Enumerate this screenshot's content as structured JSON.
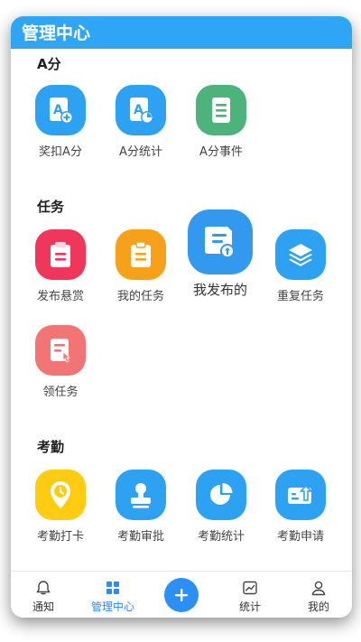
{
  "header": {
    "title": "管理中心"
  },
  "sections": {
    "a_score": {
      "title": "A分",
      "items": [
        {
          "label": "奖扣A分",
          "icon": "a-score-add-icon",
          "color": "#2ea2f2"
        },
        {
          "label": "A分统计",
          "icon": "a-score-stats-icon",
          "color": "#2ea2f2"
        },
        {
          "label": "A分事件",
          "icon": "a-score-events-icon",
          "color": "#4cb37a"
        }
      ]
    },
    "tasks": {
      "title": "任务",
      "items": [
        {
          "label": "发布悬赏",
          "icon": "publish-bounty-icon",
          "color": "#f0365a"
        },
        {
          "label": "我的任务",
          "icon": "my-tasks-icon",
          "color": "#f7a11b"
        },
        {
          "label": "我发布的",
          "icon": "my-published-icon",
          "color": "#3399ee"
        },
        {
          "label": "重复任务",
          "icon": "repeat-task-icon",
          "color": "#2ea2f2"
        },
        {
          "label": "领任务",
          "icon": "claim-task-icon",
          "color": "#f27474"
        }
      ]
    },
    "attendance": {
      "title": "考勤",
      "items": [
        {
          "label": "考勤打卡",
          "icon": "check-in-icon",
          "color": "#ffcc11"
        },
        {
          "label": "考勤审批",
          "icon": "attendance-approval-icon",
          "color": "#2ea2f2"
        },
        {
          "label": "考勤统计",
          "icon": "attendance-stats-icon",
          "color": "#2ea2f2"
        },
        {
          "label": "考勤申请",
          "icon": "attendance-request-icon",
          "color": "#2ea2f2"
        }
      ]
    }
  },
  "tabbar": {
    "items": [
      {
        "label": "通知",
        "icon": "bell-icon",
        "active": false
      },
      {
        "label": "管理中心",
        "icon": "grid-icon",
        "active": true
      },
      {
        "label": "统计",
        "icon": "chart-icon",
        "active": false
      },
      {
        "label": "我的",
        "icon": "user-icon",
        "active": false
      }
    ],
    "center_icon": "plus-icon"
  },
  "colors": {
    "accent": "#2fa6f5",
    "active_tab": "#2d8cf0"
  }
}
